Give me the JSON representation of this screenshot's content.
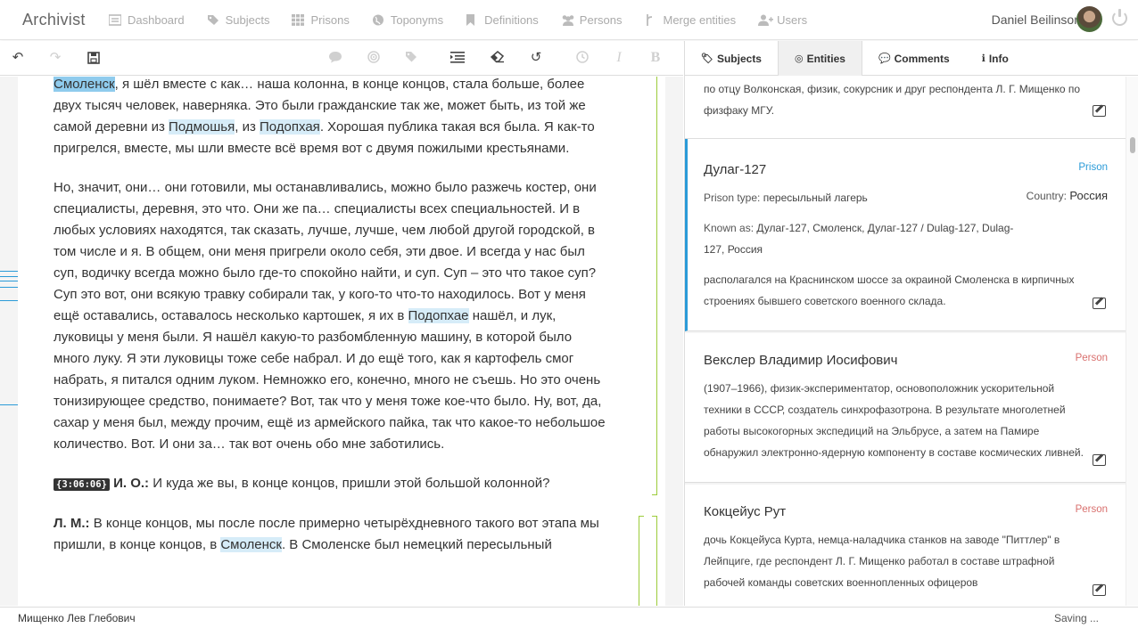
{
  "app": {
    "brand": "Archivist"
  },
  "nav": {
    "items": [
      {
        "label": "Dashboard",
        "icon": "dashboard-icon"
      },
      {
        "label": "Subjects",
        "icon": "tags-icon"
      },
      {
        "label": "Prisons",
        "icon": "grid-icon"
      },
      {
        "label": "Toponyms",
        "icon": "globe-icon"
      },
      {
        "label": "Definitions",
        "icon": "bookmark-icon"
      },
      {
        "label": "Persons",
        "icon": "users-icon"
      },
      {
        "label": "Merge entities",
        "icon": "merge-icon"
      },
      {
        "label": "Users",
        "icon": "user-plus-icon"
      }
    ],
    "user_name": "Daniel Beilinson"
  },
  "toolbar": {
    "undo": "↶",
    "redo": "↷",
    "save": "🖫",
    "comment": "💬",
    "target": "◎",
    "tag": "🏷",
    "indent": "☰",
    "eraser": "⌫",
    "revert": "↺",
    "clock": "◷",
    "italic": "I",
    "bold": "B"
  },
  "transcript": {
    "p1_a": "Смоленск",
    "p1_b": ", я шёл вместе с как… наша колонна, в конце концов, стала больше, более двух тысяч человек, наверняка. Это были гражданские так же, может быть, из той же самой деревни из ",
    "p1_c": "Подмошья",
    "p1_d": ", из ",
    "p1_e": "Подопхая",
    "p1_f": ". Хорошая публика такая вся была. Я как-то пригрелся, вместе, мы шли вместе всё время вот с двумя пожилыми крестьянами.",
    "p2_a": "Но, значит, они… они готовили, мы останавливались, можно было разжечь костер, они специалисты, деревня, это что. Они же па… специалисты всех специальностей. И в любых условиях находятся, так сказать, лучше, лучше, чем любой другой городской, в том числе и я. В общем, они меня пригрели около себя, эти двое. И всегда у нас был суп, водичку всегда можно было где-то спокойно найти, и суп. Суп – это что такое суп? Суп это вот, они всякую травку собирали так, у кого-то что-то находилось. Вот у меня ещё оставались, оставалось несколько картошек, я их в ",
    "p2_b": "Подопхае",
    "p2_c": " нашёл, и лук, луковицы у меня были. Я нашёл какую-то разбомбленную машину, в которой было много луку. Я эти луковицы тоже себе набрал. И до ещё того, как я картофель смог набрать, я питался одним луком. Немножко его, конечно, много не съешь. Но это очень тонизирующее средство, понимаете? Вот, так что у меня тоже кое-что было. Ну, вот, да, сахар у меня был, между прочим, ещё из армейского пайка, так что какое-то небольшое количество. Вот. И они за… так вот очень обо мне заботились.",
    "p3_ts": "{3:06:06}",
    "p3_spk": "И. О.:",
    "p3_text": " И куда же вы, в конце концов, пришли этой большой колонной?",
    "p4_spk": "Л. М.:",
    "p4_a": " В конце концов, мы после после примерно четырёхдневного такого вот этапа мы пришли, в конце концов, в ",
    "p4_b": "Смоленск",
    "p4_c": ". В Смоленске был немецкий пересыльный"
  },
  "panel": {
    "tabs": [
      {
        "label": "Subjects",
        "icon": "tag-icon"
      },
      {
        "label": "Entities",
        "icon": "target-icon"
      },
      {
        "label": "Comments",
        "icon": "comment-icon"
      },
      {
        "label": "Info",
        "icon": "info-icon"
      }
    ],
    "card0": {
      "desc": "по отцу Волконская, физик, сокурсник и друг респондента Л. Г. Мищенко по физфаку МГУ."
    },
    "card1": {
      "title": "Дулаг-127",
      "type": "Prison",
      "prison_type_label": "Prison type:",
      "prison_type": "пересыльный лагерь",
      "country_label": "Country:",
      "country": "Россия",
      "known_label": "Known as:",
      "known_as": "Дулаг-127, Смоленск, Дулаг-127 / Dulag-127, Dulag-127, Россия",
      "desc": "располагался на Краснинском шоссе за окраиной Смоленска в кирпичных строениях бывшего советского военного склада."
    },
    "card2": {
      "title": "Векслер Владимир Иосифович",
      "type": "Person",
      "desc": "(1907–1966), физик-экспериментатор, основоположник ускорительной техники в СССР, создатель синхрофазотрона. В результате многолетней работы высокогорных экспедиций на Эльбрусе, а затем на Памире обнаружил электронно-ядерную компоненту в составе космических ливней."
    },
    "card3": {
      "title": "Кокцейус Рут",
      "type": "Person",
      "desc": "дочь Кокцейуса Курта, немца-наладчика станков на заводе \"Питтлер\" в Лейпциге, где респондент Л. Г. Мищенко работал в составе штрафной рабочей команды советских военнопленных офицеров"
    }
  },
  "status": {
    "left": "Мищенко Лев Глебович",
    "right": "Saving ..."
  },
  "colors": {
    "prison": "#2b9bd8",
    "person": "#d9706e",
    "highlight": "#d6ecf8",
    "selected": "#8fcbed"
  }
}
